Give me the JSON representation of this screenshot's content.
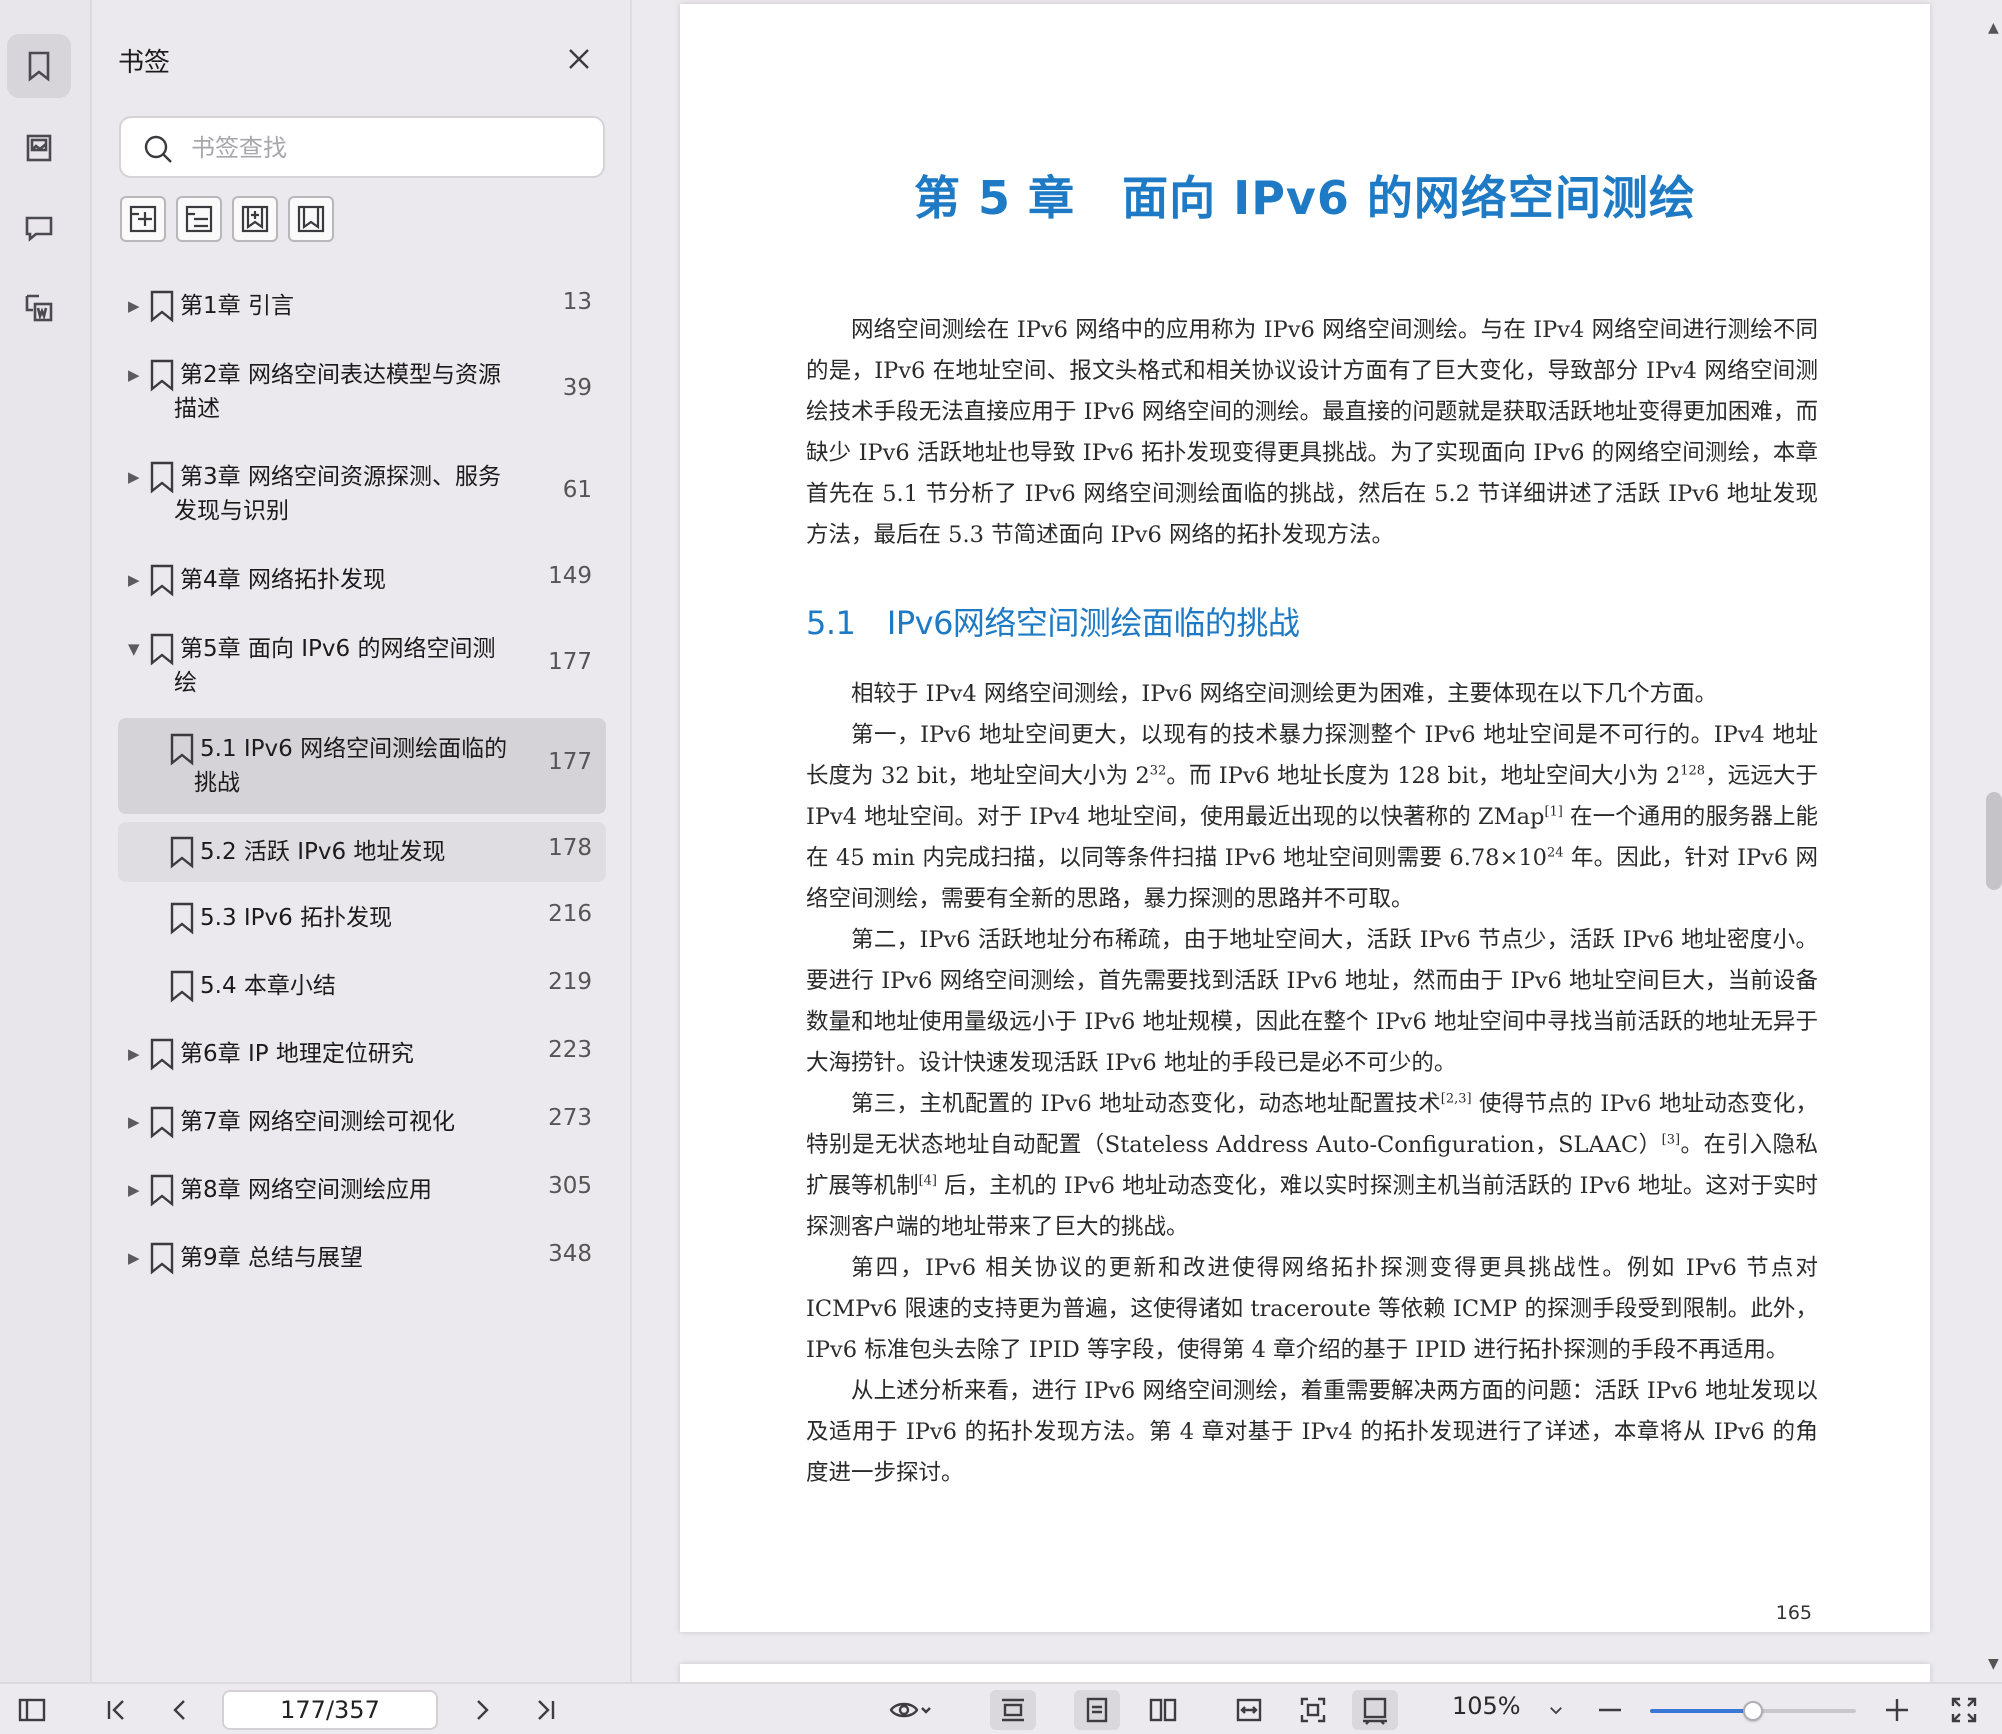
{
  "rail": {
    "icons": [
      "bookmark-icon",
      "thumbnail-icon",
      "comment-icon",
      "word-convert-icon"
    ]
  },
  "panel": {
    "title": "书签",
    "search_placeholder": "书签查找",
    "toolbar_icons": [
      "expand-all-icon",
      "collapse-all-icon",
      "add-bookmark-icon",
      "bookmark-ribbon-icon"
    ],
    "bookmarks": [
      {
        "line1": "第1章 引言",
        "line2": "",
        "page": "13",
        "arrow": "▶",
        "level": 0
      },
      {
        "line1": "第2章 网络空间表达模型与资源",
        "line2": "描述",
        "page": "39",
        "arrow": "▶",
        "level": 0
      },
      {
        "line1": "第3章 网络空间资源探测、服务",
        "line2": "发现与识别",
        "page": "61",
        "arrow": "▶",
        "level": 0
      },
      {
        "line1": "第4章 网络拓扑发现",
        "line2": "",
        "page": "149",
        "arrow": "▶",
        "level": 0
      },
      {
        "line1": "第5章 面向 IPv6 的网络空间测",
        "line2": "绘",
        "page": "177",
        "arrow": "▼",
        "level": 0
      },
      {
        "line1": "5.1 IPv6 网络空间测绘面临的",
        "line2": "挑战",
        "page": "177",
        "arrow": "",
        "level": 1
      },
      {
        "line1": "5.2 活跃 IPv6 地址发现",
        "line2": "",
        "page": "178",
        "arrow": "",
        "level": 1
      },
      {
        "line1": "5.3 IPv6 拓扑发现",
        "line2": "",
        "page": "216",
        "arrow": "",
        "level": 1
      },
      {
        "line1": "5.4 本章小结",
        "line2": "",
        "page": "219",
        "arrow": "",
        "level": 1
      },
      {
        "line1": "第6章 IP 地理定位研究",
        "line2": "",
        "page": "223",
        "arrow": "▶",
        "level": 0
      },
      {
        "line1": "第7章 网络空间测绘可视化",
        "line2": "",
        "page": "273",
        "arrow": "▶",
        "level": 0
      },
      {
        "line1": "第8章 网络空间测绘应用",
        "line2": "",
        "page": "305",
        "arrow": "▶",
        "level": 0
      },
      {
        "line1": "第9章 总结与展望",
        "line2": "",
        "page": "348",
        "arrow": "▶",
        "level": 0
      }
    ]
  },
  "document": {
    "chapter_title": "第 5 章　面向 IPv6 的网络空间测绘",
    "intro_paragraph": "网络空间测绘在 IPv6 网络中的应用称为 IPv6 网络空间测绘。与在 IPv4 网络空间进行测绘不同的是，IPv6 在地址空间、报文头格式和相关协议设计方面有了巨大变化，导致部分 IPv4 网络空间测绘技术手段无法直接应用于 IPv6 网络空间的测绘。最直接的问题就是获取活跃地址变得更加困难，而缺少 IPv6 活跃地址也导致 IPv6 拓扑发现变得更具挑战。为了实现面向 IPv6 的网络空间测绘，本章首先在 5.1 节分析了 IPv6 网络空间测绘面临的挑战，然后在 5.2 节详细讲述了活跃 IPv6 地址发现方法，最后在 5.3 节简述面向 IPv6 网络的拓扑发现方法。",
    "section_title": "5.1　IPv6网络空间测绘面临的挑战",
    "p1": "相较于 IPv4 网络空间测绘，IPv6 网络空间测绘更为困难，主要体现在以下几个方面。",
    "p2_a": "第一，IPv6 地址空间更大，以现有的技术暴力探测整个 IPv6 地址空间是不可行的。IPv4 地址长度为 32 bit，地址空间大小为 2",
    "p2_sup1": "32",
    "p2_b": "。而 IPv6 地址长度为 128 bit，地址空间大小为 2",
    "p2_sup2": "128",
    "p2_c": "，远远大于 IPv4 地址空间。对于 IPv4 地址空间，使用最近出现的以快著称的 ZMap",
    "p2_sup3": "[1]",
    "p2_d": " 在一个通用的服务器上能在 45 min 内完成扫描，以同等条件扫描 IPv6 地址空间则需要 6.78×10",
    "p2_sup4": "24",
    "p2_e": " 年。因此，针对 IPv6 网络空间测绘，需要有全新的思路，暴力探测的思路并不可取。",
    "p3": "第二，IPv6 活跃地址分布稀疏，由于地址空间大，活跃 IPv6 节点少，活跃 IPv6 地址密度小。要进行 IPv6 网络空间测绘，首先需要找到活跃 IPv6 地址，然而由于 IPv6 地址空间巨大，当前设备数量和地址使用量级远小于 IPv6 地址规模，因此在整个 IPv6 地址空间中寻找当前活跃的地址无异于大海捞针。设计快速发现活跃 IPv6 地址的手段已是必不可少的。",
    "p4_a": "第三，主机配置的 IPv6 地址动态变化，动态地址配置技术",
    "p4_sup1": "[2,3]",
    "p4_b": " 使得节点的 IPv6 地址动态变化，特别是无状态地址自动配置（Stateless Address Auto-Configuration，SLAAC）",
    "p4_sup2": "[3]",
    "p4_c": "。在引入隐私扩展等机制",
    "p4_sup3": "[4]",
    "p4_d": " 后，主机的 IPv6 地址动态变化，难以实时探测主机当前活跃的 IPv6 地址。这对于实时探测客户端的地址带来了巨大的挑战。",
    "p5": "第四，IPv6 相关协议的更新和改进使得网络拓扑探测变得更具挑战性。例如 IPv6 节点对 ICMPv6 限速的支持更为普遍，这使得诸如 traceroute 等依赖 ICMP 的探测手段受到限制。此外，IPv6 标准包头去除了 IPID 等字段，使得第 4 章介绍的基于 IPID 进行拓扑探测的手段不再适用。",
    "p6": "从上述分析来看，进行 IPv6 网络空间测绘，着重需要解决两方面的问题：活跃 IPv6 地址发现以及适用于 IPv6 的拓扑发现方法。第 4 章对基于 IPv4 的拓扑发现进行了详述，本章将从 IPv6 的角度进一步探讨。",
    "page_number": "165"
  },
  "bottombar": {
    "page_field": "177/357",
    "zoom": "105%",
    "zoom_fraction": 0.5,
    "accent": "#3a78d6"
  },
  "colors": {
    "heading_blue": "#1e7ac4"
  }
}
